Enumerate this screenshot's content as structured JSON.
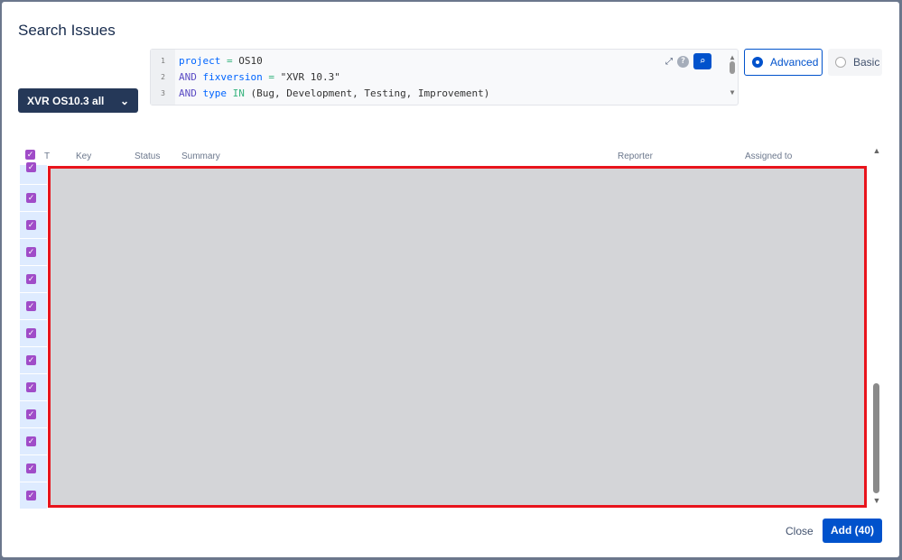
{
  "dialog": {
    "title": "Search Issues"
  },
  "filter": {
    "label": "XVR OS10.3 all"
  },
  "query": {
    "lines": [
      {
        "n": "1",
        "parts": [
          [
            "fld",
            "project"
          ],
          [
            "op",
            " = "
          ],
          [
            "",
            "OS10"
          ]
        ]
      },
      {
        "n": "2",
        "parts": [
          [
            "kw",
            "AND "
          ],
          [
            "fld",
            "fixversion"
          ],
          [
            "op",
            " = "
          ],
          [
            "",
            "\"XVR 10.3\""
          ]
        ]
      },
      {
        "n": "3",
        "parts": [
          [
            "kw",
            "AND "
          ],
          [
            "fld",
            "type"
          ],
          [
            "op",
            " IN "
          ],
          [
            "",
            "(Bug, Development, Testing, Improvement)"
          ]
        ]
      }
    ]
  },
  "modes": {
    "advanced": "Advanced",
    "basic": "Basic",
    "selected": "advanced"
  },
  "columns": {
    "type": "T",
    "key": "Key",
    "status": "Status",
    "summary": "Summary",
    "reporter": "Reporter",
    "assigned": "Assigned to"
  },
  "rows_checked": 13,
  "footer": {
    "close": "Close",
    "add": "Add (40)"
  }
}
